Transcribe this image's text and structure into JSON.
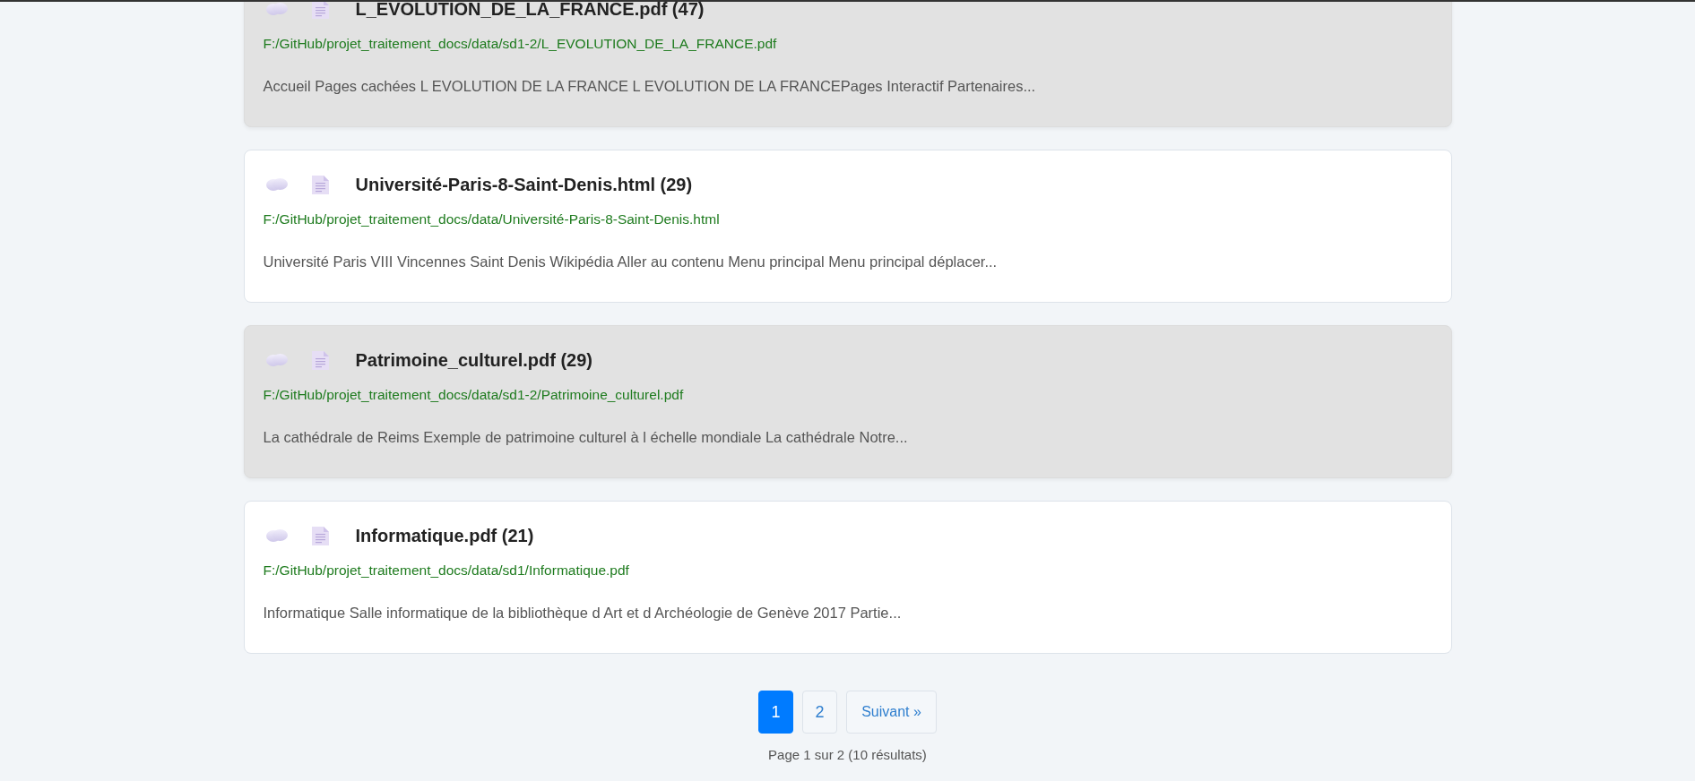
{
  "results": [
    {
      "title": "L_EVOLUTION_DE_LA_FRANCE.pdf (47)",
      "path": "F:/GitHub/projet_traitement_docs/data/sd1-2/L_EVOLUTION_DE_LA_FRANCE.pdf",
      "snippet": "Accueil Pages cachées L EVOLUTION DE LA FRANCE L EVOLUTION DE LA FRANCEPages Interactif Partenaires...",
      "highlighted": true
    },
    {
      "title": "Université-Paris-8-Saint-Denis.html (29)",
      "path": "F:/GitHub/projet_traitement_docs/data/Université-Paris-8-Saint-Denis.html",
      "snippet": "Université Paris VIII Vincennes Saint Denis Wikipédia Aller au contenu Menu principal Menu principal déplacer...",
      "highlighted": false
    },
    {
      "title": "Patrimoine_culturel.pdf (29)",
      "path": "F:/GitHub/projet_traitement_docs/data/sd1-2/Patrimoine_culturel.pdf",
      "snippet": "La cathédrale de Reims Exemple de patrimoine culturel à l échelle mondiale La cathédrale Notre...",
      "highlighted": true
    },
    {
      "title": "Informatique.pdf (21)",
      "path": "F:/GitHub/projet_traitement_docs/data/sd1/Informatique.pdf",
      "snippet": "Informatique Salle informatique de la bibliothèque d Art et d Archéologie de Genève 2017 Partie...",
      "highlighted": false
    }
  ],
  "pagination": {
    "pages": [
      {
        "label": "1",
        "selected": true
      },
      {
        "label": "2",
        "selected": false
      }
    ],
    "next": "Suivant »",
    "summary": "Page 1 sur 2 (10 résultats)"
  }
}
